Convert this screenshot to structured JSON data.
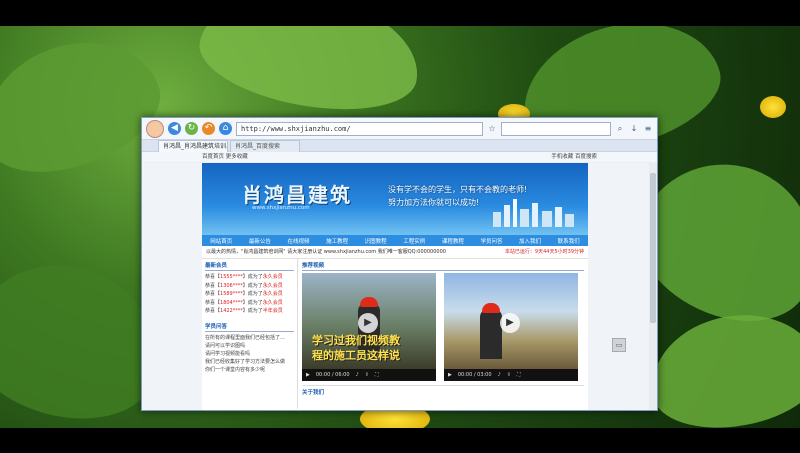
{
  "browser": {
    "url": "http://www.shxjianzhu.com/",
    "tabs": [
      "肖鸿昌_肖鸿昌建筑培训...",
      "肖鸿昌_百度搜索"
    ],
    "favbar_left": "百度首页  更多收藏",
    "favbar_right": "手机收藏  百度搜索"
  },
  "site": {
    "logo": "肖鸿昌建筑",
    "logo_url": "www.shxjianzhu.com",
    "slogan_line1": "没有学不会的学生，只有不会教的老师!",
    "slogan_line2": "努力加方法你就可以成功!",
    "menu": [
      "网站首页",
      "最新公告",
      "在线视频",
      "施工教程",
      "识图教程",
      "工程实例",
      "课程教程",
      "学员问答",
      "加入我们",
      "联系我们"
    ],
    "notice_left": "以最大的热情，\"肖鸿昌建筑培训网\" 请大家注册认证 www.shxjianzhu.com 我们唯一客服QQ:000000000",
    "notice_right": "本站已运行：9天44天5小时39分钟"
  },
  "members": {
    "heading": "最新会员",
    "rows": [
      {
        "prefix": "恭喜【",
        "num": "1555****",
        "suffix": "】成为了",
        "tag": "永久会员"
      },
      {
        "prefix": "恭喜【",
        "num": "1306****",
        "suffix": "】成为了",
        "tag": "永久会员"
      },
      {
        "prefix": "恭喜【",
        "num": "1589****",
        "suffix": "】成为了",
        "tag": "永久会员"
      },
      {
        "prefix": "恭喜【",
        "num": "1804****",
        "suffix": "】成为了",
        "tag": "永久会员"
      },
      {
        "prefix": "恭喜【",
        "num": "1422****",
        "suffix": "】成为了",
        "tag": "半年会员"
      }
    ]
  },
  "qa": {
    "heading": "学员问答",
    "items": [
      "在所有的课程里面我们已经包括了...",
      "请问可以学识图吗",
      "请问学习视频能看吗",
      "我们已经收集好了学习方法要怎么做",
      "你们一个课堂内容有多少呢"
    ]
  },
  "videos": {
    "heading": "推荐视频",
    "v1_caption_line1": "学习过我们视频教",
    "v1_caption_line2": "程的施工员这样说",
    "v1_time": "00:00 / 06:00",
    "v2_time": "00:00 / 03:00"
  },
  "about_heading": "关于我们"
}
